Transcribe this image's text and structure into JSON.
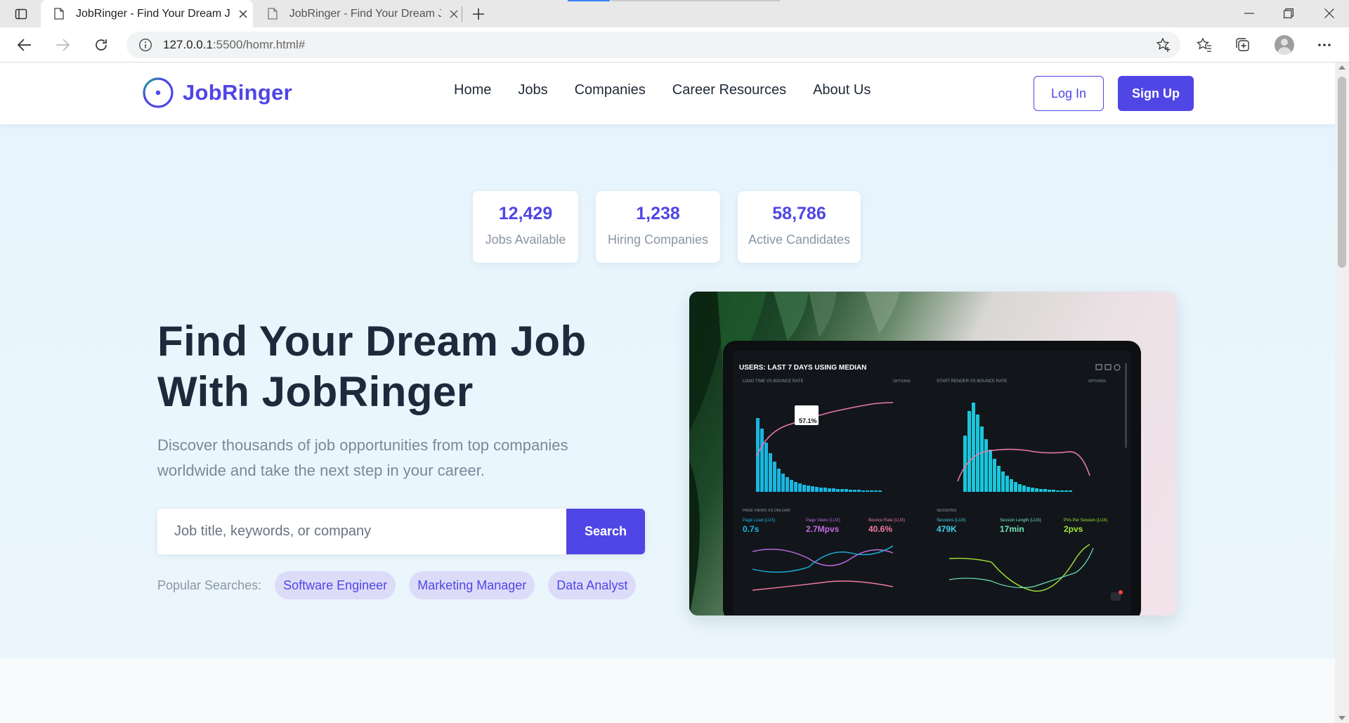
{
  "browser": {
    "tabs": [
      {
        "title": "JobRinger - Find Your Dream Job",
        "active": true
      },
      {
        "title": "JobRinger - Find Your Dream Job",
        "active": false
      }
    ],
    "url_host": "127.0.0.1",
    "url_path": ":5500/homr.html#"
  },
  "header": {
    "logo_text": "JobRinger",
    "nav": [
      "Home",
      "Jobs",
      "Companies",
      "Career Resources",
      "About Us"
    ],
    "login_label": "Log In",
    "signup_label": "Sign Up"
  },
  "stats": [
    {
      "value": "12,429",
      "label": "Jobs Available"
    },
    {
      "value": "1,238",
      "label": "Hiring Companies"
    },
    {
      "value": "58,786",
      "label": "Active Candidates"
    }
  ],
  "hero": {
    "title_line1": "Find Your Dream Job",
    "title_line2": "With JobRinger",
    "subtitle": "Discover thousands of job opportunities from top companies worldwide and take the next step in your career.",
    "search_placeholder": "Job title, keywords, or company",
    "search_button": "Search",
    "popular_label": "Popular Searches:",
    "popular": [
      "Software Engineer",
      "Marketing Manager",
      "Data Analyst"
    ]
  },
  "dashboard_image": {
    "header": "USERS: LAST 7 DAYS USING MEDIAN",
    "panel_left": "LOAD TIME VS BOUNCE RATE",
    "panel_right": "START RENDER VS BOUNCE RATE",
    "tooltip": "57.1%",
    "options": "OPTIONS",
    "bottom_left": "PAGE VIEWS VS ONLOAD",
    "bottom_right": "SESSIONS",
    "metrics": [
      {
        "label": "Page Load (LUX)",
        "value": "0.7s"
      },
      {
        "label": "Page Views (LUX)",
        "value": "2.7Mpvs"
      },
      {
        "label": "Bounce Rate (LUX)",
        "value": "40.6%"
      },
      {
        "label": "Sessions (LUX)",
        "value": "479K"
      },
      {
        "label": "Session Length (LUX)",
        "value": "17min"
      },
      {
        "label": "PVs Per Session (LUX)",
        "value": "2pvs"
      }
    ]
  },
  "colors": {
    "brand": "#4f46e5",
    "heading": "#1e293b",
    "muted": "#8b95a5",
    "hero_bg": "#e7f4fd",
    "chip_bg": "#dcdcf9"
  }
}
